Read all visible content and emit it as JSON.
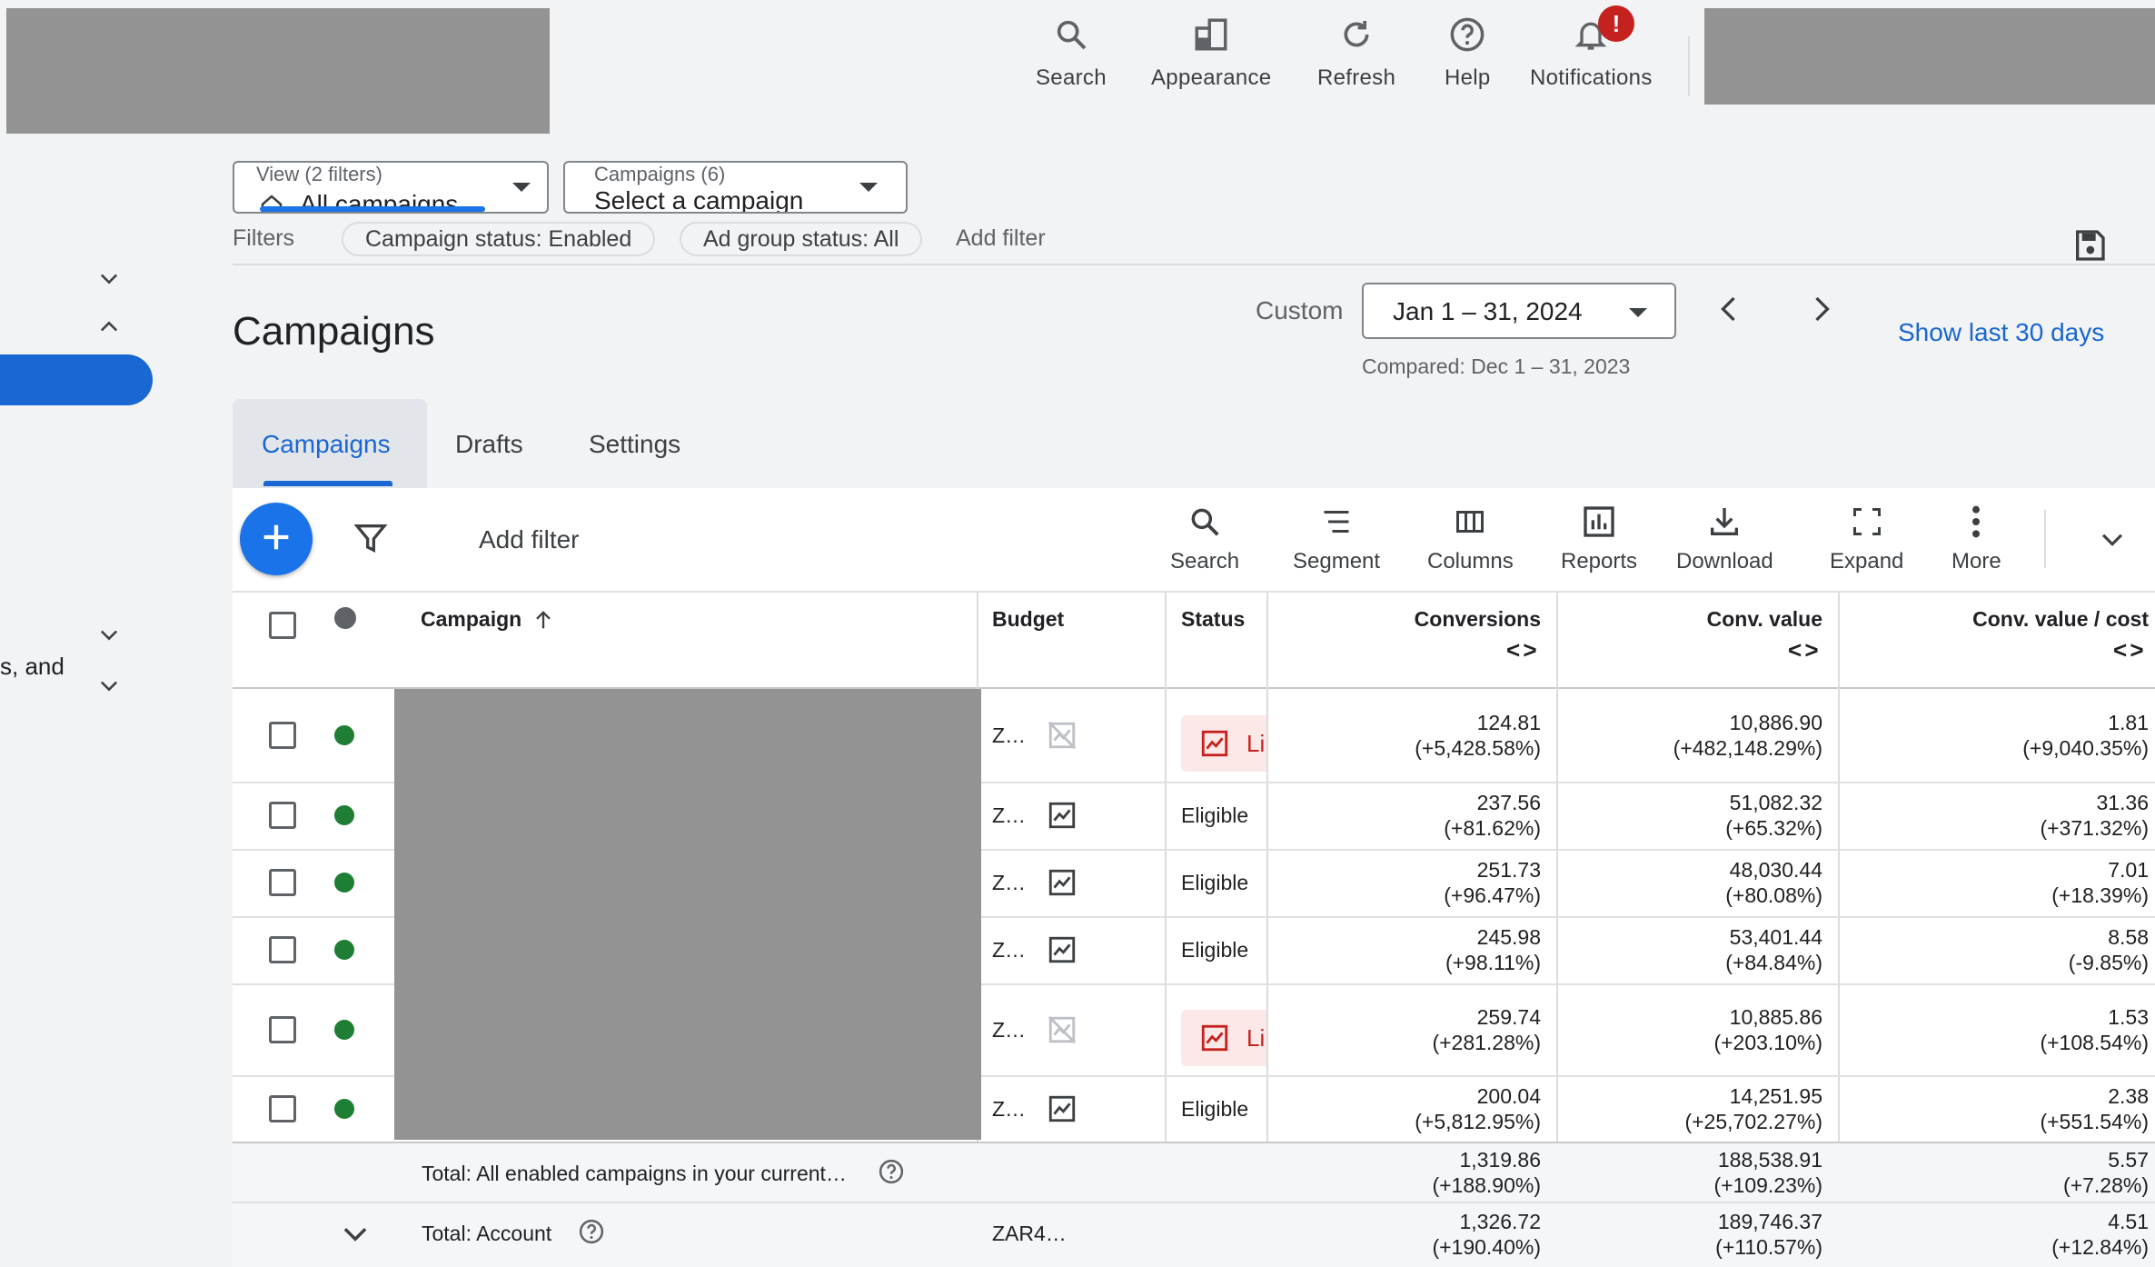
{
  "topbar": {
    "search": "Search",
    "appearance": "Appearance",
    "refresh": "Refresh",
    "help": "Help",
    "notifications": "Notifications",
    "notif_badge": "!"
  },
  "view_filter": {
    "label": "View (2 filters)",
    "value": "All campaigns"
  },
  "campaign_select": {
    "label": "Campaigns (6)",
    "value": "Select a campaign"
  },
  "filters": {
    "label": "Filters",
    "chips": [
      "Campaign status: Enabled",
      "Ad group status: All"
    ],
    "add": "Add filter"
  },
  "sidebar": {
    "partial_text": "s, and"
  },
  "page": {
    "title": "Campaigns",
    "custom_label": "Custom",
    "date_range": "Jan 1 – 31, 2024",
    "compared": "Compared: Dec 1 – 31, 2023",
    "show_last": "Show last 30 days"
  },
  "tabs": [
    "Campaigns",
    "Drafts",
    "Settings"
  ],
  "toolbar": {
    "add_filter": "Add filter",
    "search": "Search",
    "segment": "Segment",
    "columns": "Columns",
    "reports": "Reports",
    "download": "Download",
    "expand": "Expand",
    "more": "More"
  },
  "table": {
    "headers": {
      "campaign": "Campaign",
      "budget": "Budget",
      "status": "Status",
      "conversions": "Conversions",
      "conv_value": "Conv. value",
      "conv_value_cost": "Conv. value / cost"
    },
    "rows": [
      {
        "budget": "Z…",
        "status": "Li",
        "limited": true,
        "conversions": "124.81",
        "conversions_change": "(+5,428.58%)",
        "conv_value": "10,886.90",
        "conv_value_change": "(+482,148.29%)",
        "conv_cost": "1.81",
        "conv_cost_change": "(+9,040.35%)"
      },
      {
        "budget": "Z…",
        "status": "Eligible",
        "limited": false,
        "conversions": "237.56",
        "conversions_change": "(+81.62%)",
        "conv_value": "51,082.32",
        "conv_value_change": "(+65.32%)",
        "conv_cost": "31.36",
        "conv_cost_change": "(+371.32%)"
      },
      {
        "budget": "Z…",
        "status": "Eligible",
        "limited": false,
        "conversions": "251.73",
        "conversions_change": "(+96.47%)",
        "conv_value": "48,030.44",
        "conv_value_change": "(+80.08%)",
        "conv_cost": "7.01",
        "conv_cost_change": "(+18.39%)"
      },
      {
        "budget": "Z…",
        "status": "Eligible",
        "limited": false,
        "conversions": "245.98",
        "conversions_change": "(+98.11%)",
        "conv_value": "53,401.44",
        "conv_value_change": "(+84.84%)",
        "conv_cost": "8.58",
        "conv_cost_change": "(-9.85%)"
      },
      {
        "budget": "Z…",
        "status": "Li",
        "limited": true,
        "conversions": "259.74",
        "conversions_change": "(+281.28%)",
        "conv_value": "10,885.86",
        "conv_value_change": "(+203.10%)",
        "conv_cost": "1.53",
        "conv_cost_change": "(+108.54%)"
      },
      {
        "budget": "Z…",
        "status": "Eligible",
        "limited": false,
        "conversions": "200.04",
        "conversions_change": "(+5,812.95%)",
        "conv_value": "14,251.95",
        "conv_value_change": "(+25,702.27%)",
        "conv_cost": "2.38",
        "conv_cost_change": "(+551.54%)"
      }
    ],
    "total_enabled": {
      "label": "Total: All enabled campaigns in your current…",
      "conversions": "1,319.86",
      "conversions_change": "(+188.90%)",
      "conv_value": "188,538.91",
      "conv_value_change": "(+109.23%)",
      "conv_cost": "5.57",
      "conv_cost_change": "(+7.28%)"
    },
    "total_account": {
      "label": "Total: Account",
      "budget": "ZAR4…",
      "conversions": "1,326.72",
      "conversions_change": "(+190.40%)",
      "conv_value": "189,746.37",
      "conv_value_change": "(+110.57%)",
      "conv_cost": "4.51",
      "conv_cost_change": "(+12.84%)"
    }
  },
  "colors": {
    "accent": "#1a73e8",
    "active_dot": "#1e7e34",
    "limited": "#c5221f"
  }
}
